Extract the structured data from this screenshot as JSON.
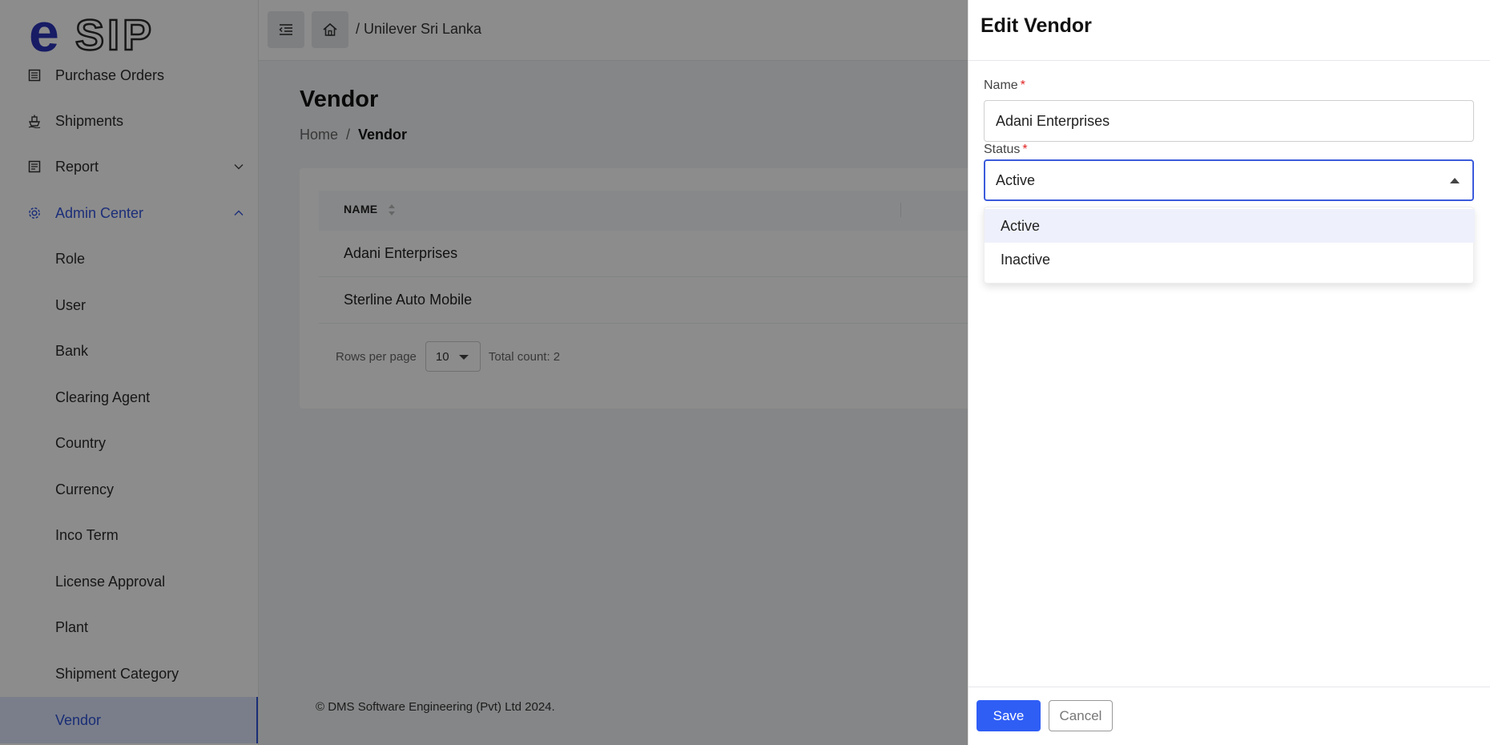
{
  "app": {
    "logo_text": "esip"
  },
  "topbar": {
    "breadcrumb": "/ Unilever Sri Lanka"
  },
  "sidebar": {
    "items": [
      {
        "label": "Purchase Orders",
        "icon": "list-icon"
      },
      {
        "label": "Shipments",
        "icon": "ship-icon"
      },
      {
        "label": "Report",
        "icon": "report-icon",
        "expandable": true
      },
      {
        "label": "Admin Center",
        "icon": "gear-icon",
        "expanded": true
      },
      {
        "label": "Role"
      },
      {
        "label": "User"
      },
      {
        "label": "Bank"
      },
      {
        "label": "Clearing Agent"
      },
      {
        "label": "Country"
      },
      {
        "label": "Currency"
      },
      {
        "label": "Inco Term"
      },
      {
        "label": "License Approval"
      },
      {
        "label": "Plant"
      },
      {
        "label": "Shipment Category"
      },
      {
        "label": "Vendor",
        "selected": true
      }
    ]
  },
  "main": {
    "title": "Vendor",
    "breadcrumb": {
      "home": "Home",
      "separator": "/",
      "current": "Vendor"
    },
    "table": {
      "columns": [
        "NAME"
      ],
      "rows": [
        "Adani Enterprises",
        "Sterline Auto Mobile"
      ]
    },
    "pager": {
      "rows_per_page_label": "Rows per page",
      "rows_per_page": "10",
      "total": "Total count: 2"
    }
  },
  "footer": {
    "copyright": "© DMS Software Engineering (Pvt) Ltd 2024."
  },
  "drawer": {
    "title": "Edit Vendor",
    "name_label": "Name",
    "name_value": "Adani Enterprises",
    "status_label": "Status",
    "status_value": "Active",
    "status_options": [
      "Active",
      "Inactive"
    ],
    "required_mark": "*",
    "save_label": "Save",
    "cancel_label": "Cancel"
  },
  "colors": {
    "primary": "#2f5ef5",
    "accent": "#3355dd",
    "required": "#e02424"
  }
}
